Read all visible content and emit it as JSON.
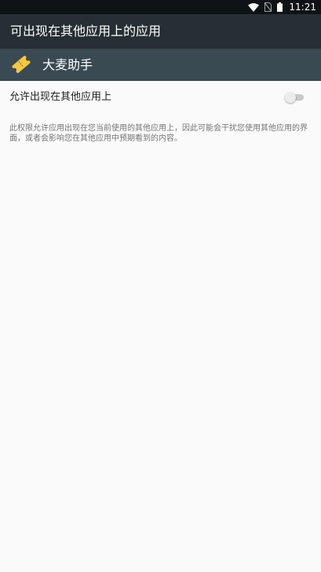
{
  "status_bar": {
    "time": "11:21",
    "icons": [
      "wifi-icon",
      "no-sim-icon",
      "battery-icon"
    ]
  },
  "app_bar": {
    "title": "可出现在其他应用上的应用"
  },
  "app_header": {
    "app_name": "大麦助手",
    "icon": "ticket-icon",
    "icon_color": "#f7c744"
  },
  "setting": {
    "label": "允许出现在其他应用上",
    "enabled": false
  },
  "description": "此权限允许应用出现在您当前使用的其他应用上，因此可能会干扰您使用其他应用的界面，或者会影响您在其他应用中预期看到的内容。",
  "colors": {
    "status_bar": "#0f1316",
    "app_bar": "#262f33",
    "app_header": "#3a4a52",
    "background": "#fafafa"
  }
}
